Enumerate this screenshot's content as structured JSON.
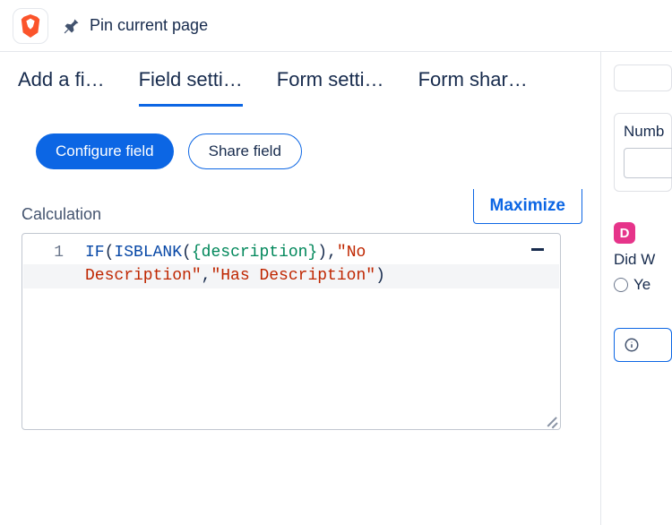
{
  "toolbar": {
    "pin_label": "Pin current page"
  },
  "tabs": {
    "add_field": "Add a fi…",
    "field_settings": "Field setti…",
    "form_settings": "Form setti…",
    "form_sharing": "Form shar…"
  },
  "buttons": {
    "configure": "Configure field",
    "share": "Share field",
    "maximize": "Maximize"
  },
  "calc": {
    "label": "Calculation",
    "line_no": "1",
    "code": {
      "fn_if": "IF",
      "fn_isblank": "ISBLANK",
      "field": "{description}",
      "str1": "\"No Description\"",
      "str2": "\"Has Description\""
    }
  },
  "sidebar": {
    "number_label": "Numb",
    "d_chip": "D",
    "did_w_label": "Did W",
    "yes_label": "Ye"
  }
}
